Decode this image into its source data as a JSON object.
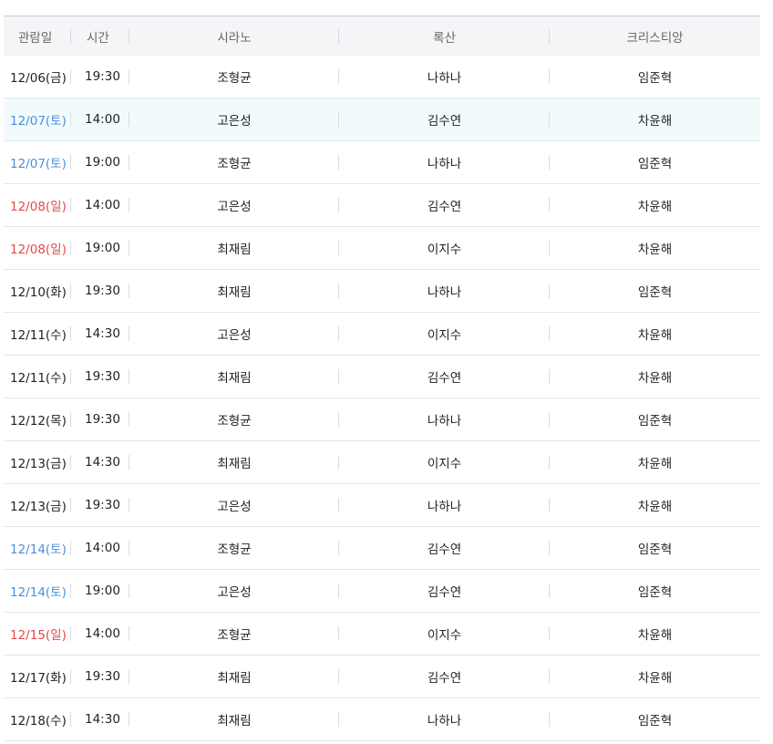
{
  "columns": {
    "date": "관람일",
    "time": "시간",
    "cyrano": "시라노",
    "roxane": "록산",
    "christian": "크리스티앙"
  },
  "rows": [
    {
      "date": "12/06(금)",
      "day_type": "normal",
      "time": "19:30",
      "cyrano": "조형균",
      "roxane": "나하나",
      "christian": "임준혁",
      "highlight": false
    },
    {
      "date": "12/07(토)",
      "day_type": "sat",
      "time": "14:00",
      "cyrano": "고은성",
      "roxane": "김수연",
      "christian": "차윤해",
      "highlight": true
    },
    {
      "date": "12/07(토)",
      "day_type": "sat",
      "time": "19:00",
      "cyrano": "조형균",
      "roxane": "나하나",
      "christian": "임준혁",
      "highlight": false
    },
    {
      "date": "12/08(일)",
      "day_type": "sun",
      "time": "14:00",
      "cyrano": "고은성",
      "roxane": "김수연",
      "christian": "차윤해",
      "highlight": false
    },
    {
      "date": "12/08(일)",
      "day_type": "sun",
      "time": "19:00",
      "cyrano": "최재림",
      "roxane": "이지수",
      "christian": "차윤해",
      "highlight": false
    },
    {
      "date": "12/10(화)",
      "day_type": "normal",
      "time": "19:30",
      "cyrano": "최재림",
      "roxane": "나하나",
      "christian": "임준혁",
      "highlight": false
    },
    {
      "date": "12/11(수)",
      "day_type": "normal",
      "time": "14:30",
      "cyrano": "고은성",
      "roxane": "이지수",
      "christian": "차윤해",
      "highlight": false
    },
    {
      "date": "12/11(수)",
      "day_type": "normal",
      "time": "19:30",
      "cyrano": "최재림",
      "roxane": "김수연",
      "christian": "차윤해",
      "highlight": false
    },
    {
      "date": "12/12(목)",
      "day_type": "normal",
      "time": "19:30",
      "cyrano": "조형균",
      "roxane": "나하나",
      "christian": "임준혁",
      "highlight": false
    },
    {
      "date": "12/13(금)",
      "day_type": "normal",
      "time": "14:30",
      "cyrano": "최재림",
      "roxane": "이지수",
      "christian": "차윤해",
      "highlight": false
    },
    {
      "date": "12/13(금)",
      "day_type": "normal",
      "time": "19:30",
      "cyrano": "고은성",
      "roxane": "나하나",
      "christian": "차윤해",
      "highlight": false
    },
    {
      "date": "12/14(토)",
      "day_type": "sat",
      "time": "14:00",
      "cyrano": "조형균",
      "roxane": "김수연",
      "christian": "임준혁",
      "highlight": false
    },
    {
      "date": "12/14(토)",
      "day_type": "sat",
      "time": "19:00",
      "cyrano": "고은성",
      "roxane": "김수연",
      "christian": "임준혁",
      "highlight": false
    },
    {
      "date": "12/15(일)",
      "day_type": "sun",
      "time": "14:00",
      "cyrano": "조형균",
      "roxane": "이지수",
      "christian": "차윤해",
      "highlight": false
    },
    {
      "date": "12/17(화)",
      "day_type": "normal",
      "time": "19:30",
      "cyrano": "최재림",
      "roxane": "김수연",
      "christian": "차윤해",
      "highlight": false
    },
    {
      "date": "12/18(수)",
      "day_type": "normal",
      "time": "14:30",
      "cyrano": "최재림",
      "roxane": "나하나",
      "christian": "임준혁",
      "highlight": false
    }
  ],
  "colors": {
    "saturday": "#4a8fdc",
    "sunday": "#e04a4a",
    "highlight_row": "#f2fbfb",
    "header_bg": "#f4f5f7"
  }
}
